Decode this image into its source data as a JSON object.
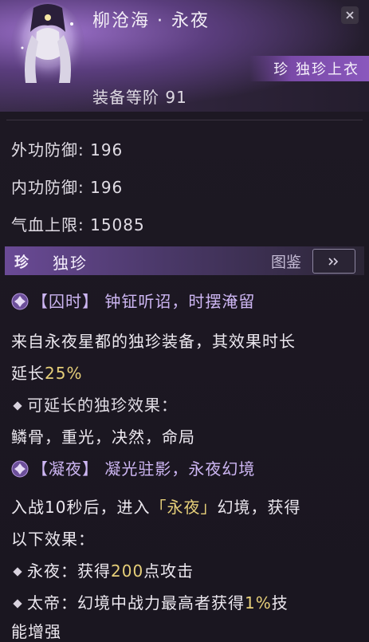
{
  "header": {
    "title": "柳沧海 · 永夜",
    "rarity_label": "珍 独珍上衣",
    "gear_level": "装备等阶 91"
  },
  "stats": [
    {
      "label": "外功防御",
      "value": "196"
    },
    {
      "label": "内功防御",
      "value": "196"
    },
    {
      "label": "气血上限",
      "value": "15085"
    }
  ],
  "section": {
    "gem_label": "珍",
    "name": "独珍",
    "atlas_label": "图鉴"
  },
  "effects": {
    "effect1": {
      "bracket_open": "【",
      "tag": "囚时",
      "bracket_close": "】",
      "title": "钟钲听诏，时摆淹留",
      "desc_line1": "来自永夜星都的独珍装备，其效果时长",
      "desc_line2_prefix": "延长",
      "desc_line2_value": "25%",
      "sub_heading": "可延长的独珍效果：",
      "sub_list": "鳞骨，重光，决然，命局"
    },
    "effect2": {
      "bracket_open": "【",
      "tag": "凝夜",
      "bracket_close": "】",
      "title": "凝光驻影，永夜幻境",
      "desc_line1_prefix": "入战10秒后，进入",
      "desc_line1_quote": "「永夜」",
      "desc_line1_suffix": "幻境，获得",
      "desc_line2": "以下效果：",
      "bullet1_label": "永夜：",
      "bullet1_prefix": "获得",
      "bullet1_value": "200",
      "bullet1_suffix": "点攻击",
      "bullet2_label": "太帝：",
      "bullet2_prefix": "幻境中战力最高者获得",
      "bullet2_value": "1%",
      "bullet2_suffix": "技",
      "bullet2_line2": "能增强"
    }
  },
  "colors": {
    "accent_purple": "#8a58bd",
    "highlight_gold": "#e6cf79",
    "effect_heading": "#cdb6f3"
  }
}
